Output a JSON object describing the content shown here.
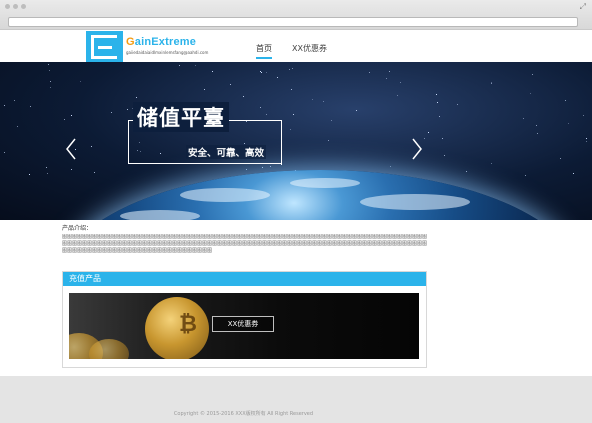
{
  "header": {
    "logo_name": "GainExtreme",
    "logo_name_first": "G",
    "logo_name_rest": "ainExtreme",
    "logo_subtext": "gaiiedaidaiaidlmxinlemsfang@aahdi.com",
    "nav": [
      {
        "label": "首页",
        "active": true
      },
      {
        "label": "XX优惠券",
        "active": false
      }
    ]
  },
  "banner": {
    "slogan": "储值平臺",
    "subslogan": "安全、可靠、高效"
  },
  "intro": {
    "label": "产品介绍：",
    "text": "图图图图图图图图图图图图图图图图图图图图图图图图图图图图图图图图图图图图图图图图图图图图图图图图图图图图图图图图图图图图图图图图图图图图图图图图图图图图图图图图图图图图图图图图图图图图图图图图图图图图图图图图图图图图图图图图图图图图图图图图图图图图图图图图图图图图图图图图图图图图图图图图图图图图图图图图图图图图图图图图图图图图图图图图图图图图图图图图"
  },
  "product": {
    "title": "充值产品",
    "coupon_label": "XX优惠券"
  },
  "footer": {
    "copyright": "Copyright © 2015-2016 XXX版权所有  All Right Reserved"
  },
  "colors": {
    "accent": "#2bb3ea",
    "logo_first_letter": "#f39c12"
  },
  "icons": {
    "prev": "chevron-left-icon",
    "next": "chevron-right-icon"
  }
}
